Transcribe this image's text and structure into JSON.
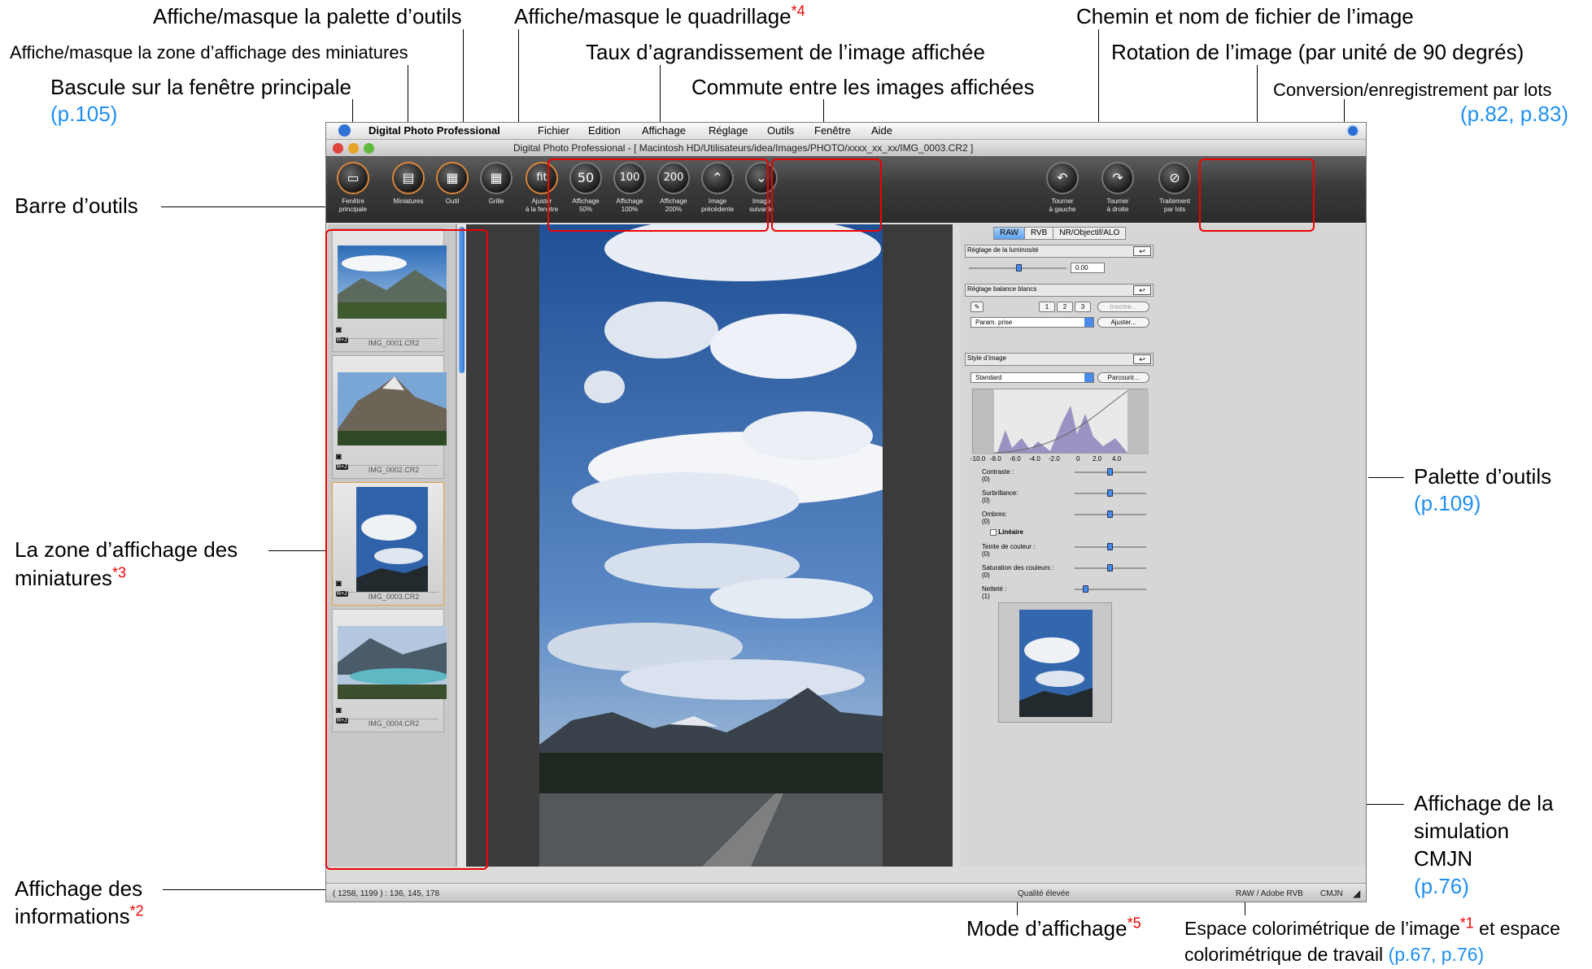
{
  "annotations": {
    "toolpalette_toggle": "Affiche/masque la palette d’outils",
    "grid_toggle": "Affiche/masque le quadrillage",
    "grid_toggle_star": "*4",
    "path_filename": "Chemin et nom de fichier de l’image",
    "thumb_toggle": "Affiche/masque la zone d’affichage des miniatures",
    "zoom_ratio": "Taux d’agrandissement de l’image affichée",
    "rotation": "Rotation de l’image (par unité de 90 degrés)",
    "main_window": "Bascule sur la fenêtre principale",
    "main_window_ref": "(p.105)",
    "switch_images": "Commute entre les images affichées",
    "batch": "Conversion/enregistrement par lots",
    "batch_ref": "(p.82, p.83)",
    "toolbar": "Barre d’outils",
    "palette": "Palette d’outils",
    "palette_ref": "(p.109)",
    "thumb_area_1": "La zone d’affichage des",
    "thumb_area_2": "miniatures",
    "thumb_area_star": "*3",
    "cmyk_1": "Affichage de la",
    "cmyk_2": "simulation",
    "cmyk_3": "CMJN",
    "cmyk_ref": "(p.76)",
    "info_1": "Affichage des",
    "info_2": "informations",
    "info_star": "*2",
    "display_mode": "Mode d’affichage",
    "display_mode_star": "*5",
    "colorspace_1a": "Espace colorimétrique de l’image",
    "colorspace_1star": "*1",
    "colorspace_1b": " et espace",
    "colorspace_2": "colorimétrique de travail ",
    "colorspace_ref": "(p.67, p.76)"
  },
  "menubar": {
    "app": "Digital Photo Professional",
    "items": [
      "Fichier",
      "Edition",
      "Affichage",
      "Réglage",
      "Outils",
      "Fenêtre",
      "Aide"
    ]
  },
  "window": {
    "title": "Digital Photo Professional - [ Macintosh HD/Utilisateurs/idea/Images/PHOTO/xxxx_xx_xx/IMG_0003.CR2 ]"
  },
  "toolbar": {
    "buttons": [
      {
        "glyph": "▭",
        "l1": "Fenêtre",
        "l2": "principale"
      },
      {
        "glyph": "▤",
        "l1": "Miniatures",
        "l2": ""
      },
      {
        "glyph": "▦",
        "l1": "Outil",
        "l2": ""
      },
      {
        "glyph": "▦",
        "l1": "Grille",
        "l2": ""
      },
      {
        "glyph": "fit",
        "l1": "Ajuster",
        "l2": "à la fenêtre"
      },
      {
        "glyph": "50",
        "l1": "Affichage",
        "l2": "50%"
      },
      {
        "glyph": "100",
        "l1": "Affichage",
        "l2": "100%"
      },
      {
        "glyph": "200",
        "l1": "Affichage",
        "l2": "200%"
      },
      {
        "glyph": "⌃",
        "l1": "Image",
        "l2": "précédente"
      },
      {
        "glyph": "⌄",
        "l1": "Image",
        "l2": "suivante"
      },
      {
        "glyph": "↶",
        "l1": "Tourner",
        "l2": "à gauche"
      },
      {
        "glyph": "↷",
        "l1": "Tourner",
        "l2": "à droite"
      },
      {
        "glyph": "⊘",
        "l1": "Traitement",
        "l2": "par lots"
      }
    ]
  },
  "thumbnails": [
    {
      "filename": "IMG_0001.CR2",
      "badge": "R+J"
    },
    {
      "filename": "IMG_0002.CR2",
      "badge": "R+J"
    },
    {
      "filename": "IMG_0003.CR2",
      "badge": "R+J"
    },
    {
      "filename": "IMG_0004.CR2",
      "badge": "R+J"
    }
  ],
  "palette": {
    "tabs": [
      "RAW",
      "RVB",
      "NR/Objectif/ALO"
    ],
    "brightness_title": "Réglage de la luminosité",
    "brightness_value": "0.00",
    "wb_title": "Réglage balance blancs",
    "wb_buttons": [
      "1",
      "2",
      "3"
    ],
    "wb_register": "Inscrire...",
    "wb_select": "Param. prise",
    "wb_adjust": "Ajuster...",
    "style_title": "Style d’image",
    "style_select": "Standard",
    "style_browse": "Parcourir...",
    "histogram_ticks": [
      "-10.0",
      "-8.0",
      "-6.0",
      "-4.0",
      "-2.0",
      "0",
      "2.0",
      "4.0"
    ],
    "sliders": [
      {
        "label": "Contraste :",
        "value": "(0)"
      },
      {
        "label": "Surbrillance:",
        "value": "(0)"
      },
      {
        "label": "Ombres:",
        "value": "(0)"
      },
      {
        "label": "Teinte de couleur :",
        "value": "(0)"
      },
      {
        "label": "Saturation des couleurs :",
        "value": "(0)"
      },
      {
        "label": "Netteté :",
        "value": "(1)"
      }
    ],
    "linear_label": "Linéaire"
  },
  "status": {
    "info": "( 1258, 1199 ) : 136, 145, 178",
    "mode": "Qualité élevée",
    "colorspace": "RAW / Adobe RVB",
    "cmyk": "CMJN"
  },
  "colors": {
    "accent": "#1e8ff0",
    "highlight": "#e00000",
    "selection": "#e0a040"
  }
}
